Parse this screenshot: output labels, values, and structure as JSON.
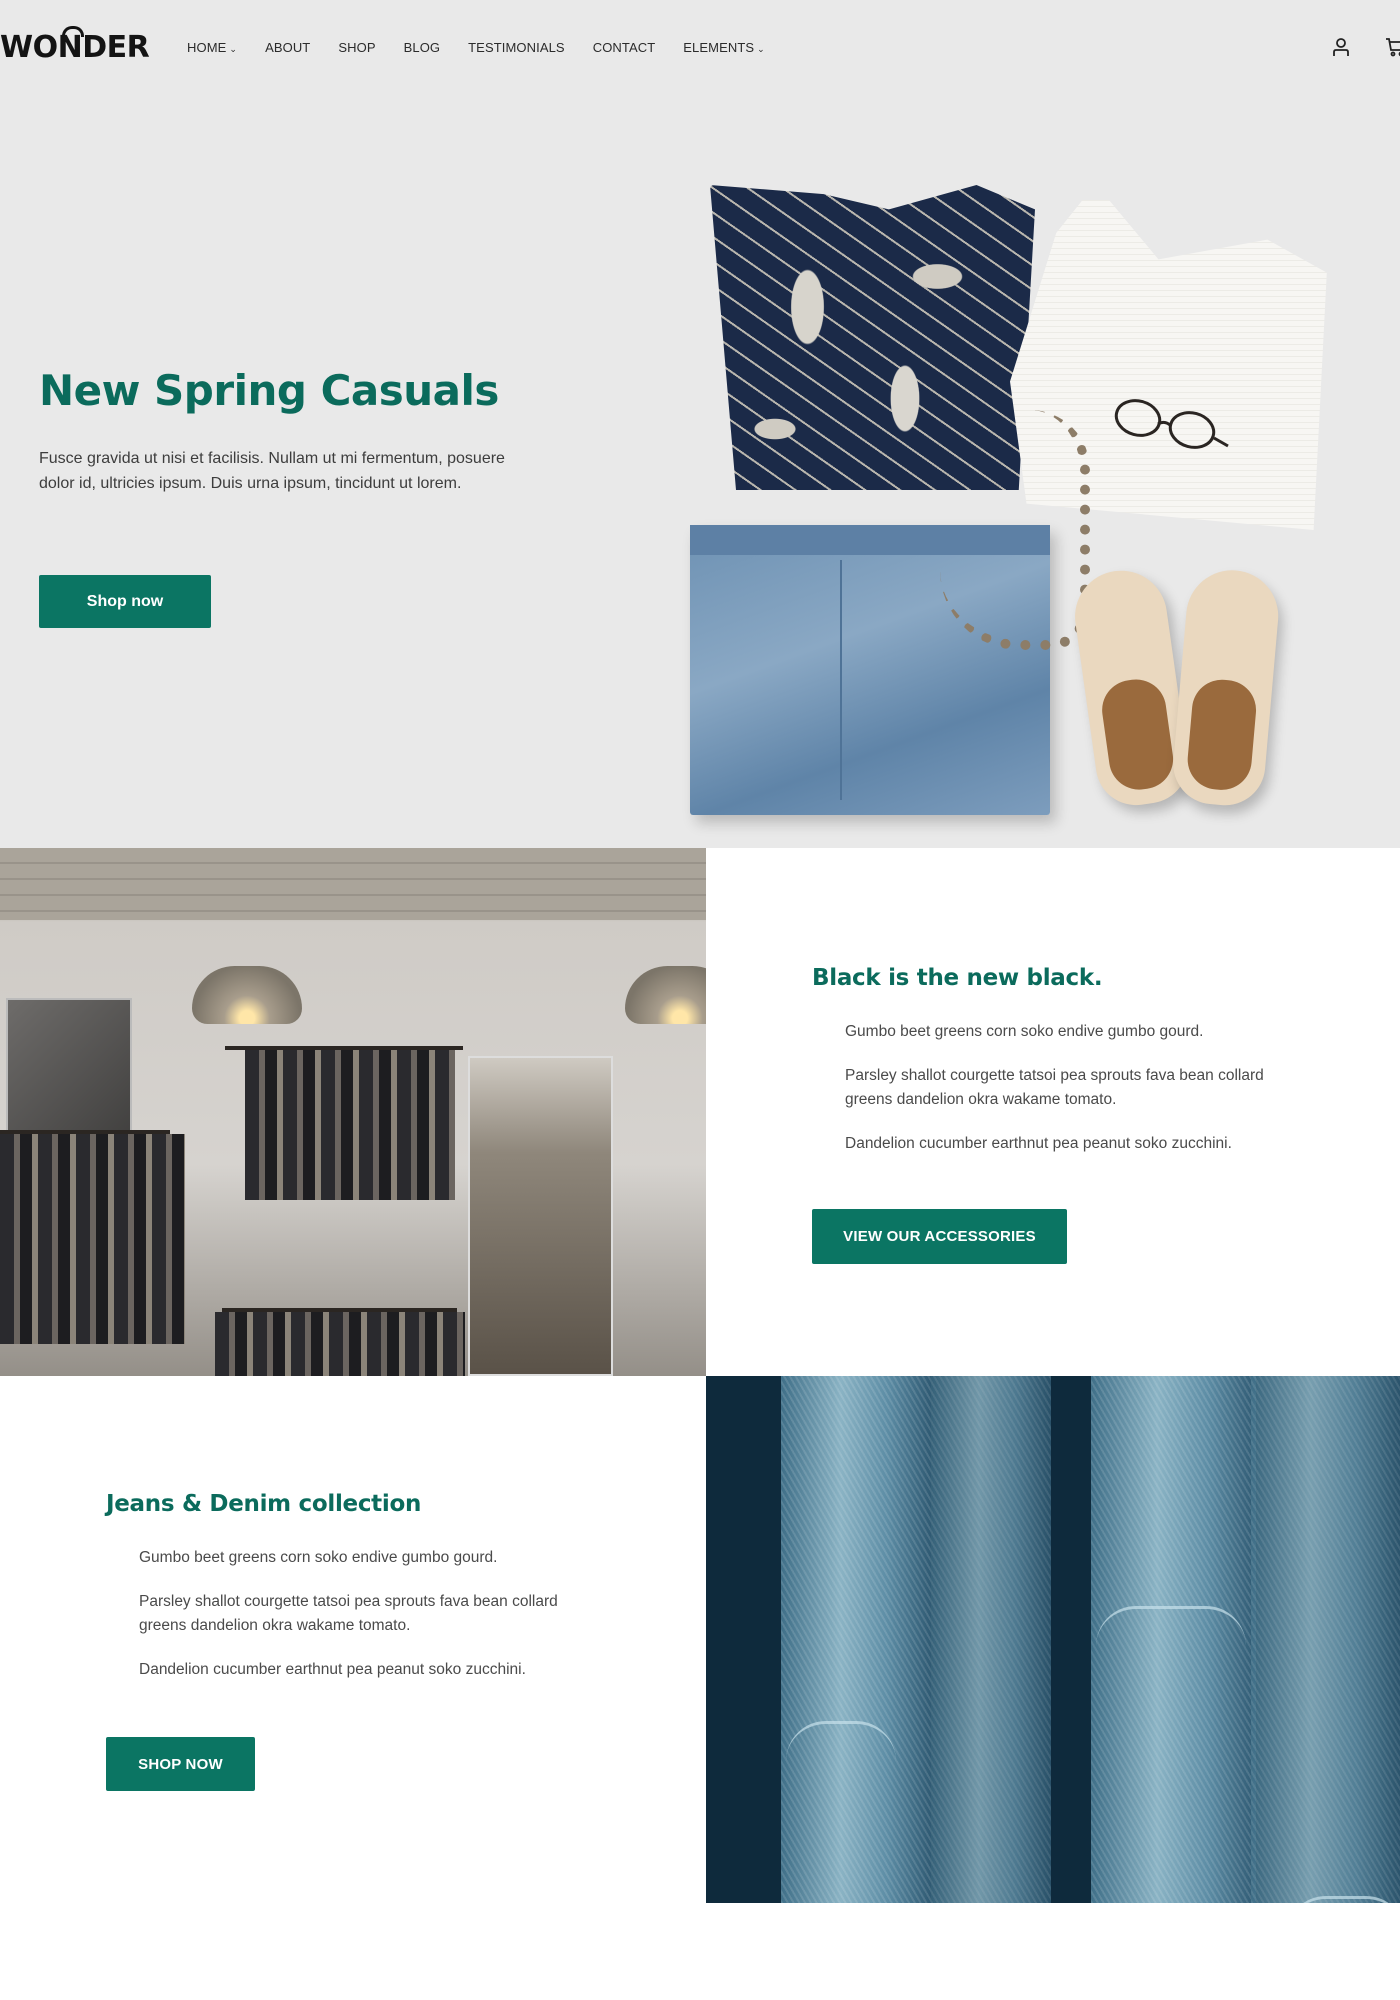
{
  "brand": {
    "logo_text_pre": "WO",
    "logo_text_mid": "N",
    "logo_text_post": "DER"
  },
  "nav": {
    "items": [
      {
        "label": "HOME",
        "has_dropdown": true
      },
      {
        "label": "ABOUT",
        "has_dropdown": false
      },
      {
        "label": "SHOP",
        "has_dropdown": false
      },
      {
        "label": "BLOG",
        "has_dropdown": false
      },
      {
        "label": "TESTIMONIALS",
        "has_dropdown": false
      },
      {
        "label": "CONTACT",
        "has_dropdown": false
      },
      {
        "label": "ELEMENTS",
        "has_dropdown": true
      }
    ],
    "dropdown_glyph": "⌄",
    "icons": [
      "user-icon",
      "cart-icon"
    ]
  },
  "hero": {
    "title": "New Spring Casuals",
    "text": "Fusce gravida ut nisi et facilisis. Nullam ut mi fermentum, posuere dolor id, ultricies ipsum. Duis urna ipsum, tincidunt ut lorem.",
    "button": "Shop now",
    "image_alt": "Flat-lay outfit: tropical print top, white knit tank, glasses, necklace, denim shorts, brogue shoes"
  },
  "section_accessories": {
    "title": "Black is the new black.",
    "items": [
      "Gumbo beet greens corn soko endive gumbo gourd.",
      "Parsley shallot courgette tatsoi pea sprouts fava bean collard greens dandelion okra wakame tomato.",
      "Dandelion cucumber earthnut pea peanut soko zucchini."
    ],
    "button": "VIEW OUR ACCESSORIES",
    "image_alt": "Clothing store interior with hanging racks and pendant lamps"
  },
  "section_denim": {
    "title": "Jeans & Denim collection",
    "items": [
      "Gumbo beet greens corn soko endive gumbo gourd.",
      "Parsley shallot courgette tatsoi pea sprouts fava bean collard greens dandelion okra wakame tomato.",
      "Dandelion cucumber earthnut pea peanut soko zucchini."
    ],
    "button": "SHOP NOW",
    "image_alt": "Close-up of hanging denim jeans"
  },
  "colors": {
    "accent": "#0b7563",
    "heading": "#0b6b5c",
    "hero_bg": "#e9e9e9",
    "text": "#3d3d3d"
  }
}
